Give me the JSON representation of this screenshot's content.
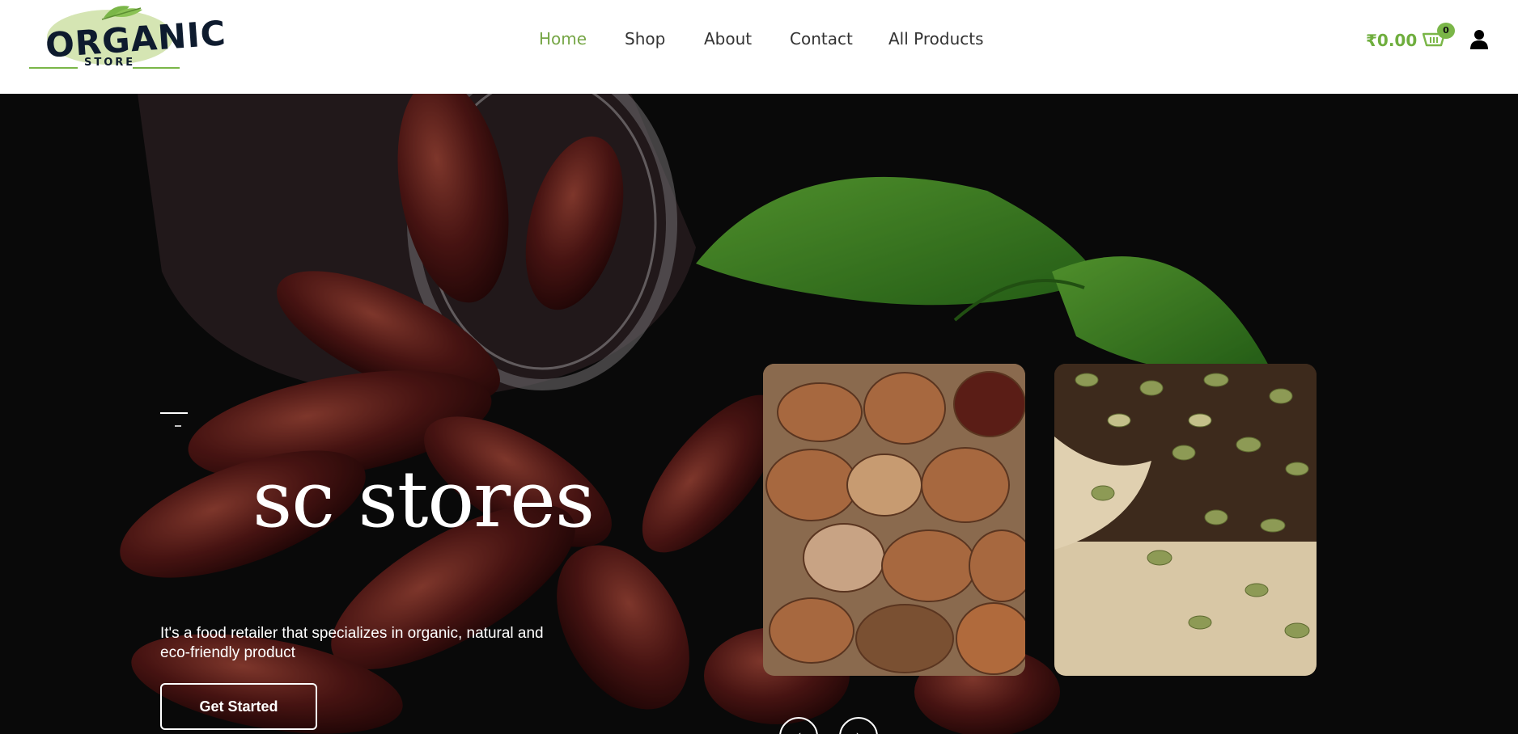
{
  "header": {
    "logo_word": "ORGANIC",
    "logo_sub": "STORE",
    "nav": [
      {
        "label": "Home",
        "active": true
      },
      {
        "label": "Shop",
        "active": false
      },
      {
        "label": "About",
        "active": false
      },
      {
        "label": "Contact",
        "active": false
      },
      {
        "label": "All Products",
        "active": false
      }
    ],
    "cart_total": "₹0.00",
    "cart_count": "0",
    "icons": [
      "cart-icon",
      "user-icon"
    ]
  },
  "hero": {
    "title": "sc stores",
    "description": "It's a food retailer that specializes in organic, natural and eco-friendly product",
    "cta_label": "Get Started",
    "slider_prev": "‹",
    "slider_next": "›"
  },
  "colors": {
    "accent": "#76a646",
    "price": "#6fae3e",
    "hero_bg": "#0c0c0c",
    "text_dark": "#333333"
  }
}
